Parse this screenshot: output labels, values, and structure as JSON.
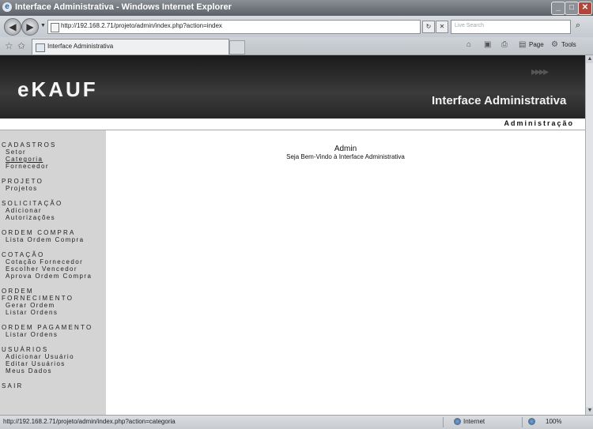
{
  "window": {
    "title": "Interface Administrativa - Windows Internet Explorer",
    "buttons": [
      "_",
      "□",
      "✕"
    ]
  },
  "toolbar": {
    "url": "http://192.168.2.71/projeto/admin/index.php?action=index",
    "search_placeholder": "Live Search",
    "search_icon": "search-icon",
    "refresh_icon": "↻",
    "stop_icon": "✕"
  },
  "tabbar": {
    "tab_label": "Interface Administrativa",
    "page_label": "Page",
    "tools_label": "Tools"
  },
  "page": {
    "logo_text": "eKAUF",
    "header_title": "Interface Administrativa",
    "subheader_label": "Administração",
    "welcome_title": "Admin",
    "welcome_text": "Seja Bem-Vindo à Interface Administrativa"
  },
  "menu": [
    {
      "heading": "CADASTROS",
      "items": [
        {
          "label": "Setor",
          "active": false
        },
        {
          "label": "Categoria",
          "active": true
        },
        {
          "label": "Fornecedor",
          "active": false
        }
      ]
    },
    {
      "heading": "PROJETO",
      "items": [
        {
          "label": "Projetos",
          "active": false
        }
      ]
    },
    {
      "heading": "SOLICITAÇÃO",
      "items": [
        {
          "label": "Adicionar",
          "active": false
        },
        {
          "label": "Autorizações",
          "active": false
        }
      ]
    },
    {
      "heading": "ORDEM COMPRA",
      "items": [
        {
          "label": "Lista Ordem Compra",
          "active": false
        }
      ]
    },
    {
      "heading": "COTAÇÃO",
      "items": [
        {
          "label": "Cotação Fornecedor",
          "active": false
        },
        {
          "label": "Escolher Vencedor",
          "active": false
        },
        {
          "label": "Aprova Ordem Compra",
          "active": false
        }
      ]
    },
    {
      "heading": "ORDEM FORNECIMENTO",
      "items": [
        {
          "label": "Gerar Ordem",
          "active": false
        },
        {
          "label": "Listar Ordens",
          "active": false
        }
      ]
    },
    {
      "heading": "ORDEM PAGAMENTO",
      "items": [
        {
          "label": "Listar Ordens",
          "active": false
        }
      ]
    },
    {
      "heading": "USUÁRIOS",
      "items": [
        {
          "label": "Adicionar Usuário",
          "active": false
        },
        {
          "label": "Editar Usuários",
          "active": false
        },
        {
          "label": "Meus Dados",
          "active": false
        }
      ]
    },
    {
      "heading": "SAIR",
      "items": []
    }
  ],
  "statusbar": {
    "text": "http://192.168.2.71/projeto/admin/index.php?action=categoria",
    "zone": "Internet",
    "zoom": "100%"
  },
  "colors": {
    "header_bg": "#262626",
    "sidebar_bg": "#d4d4d4",
    "chrome_bg": "#c5cad0"
  }
}
